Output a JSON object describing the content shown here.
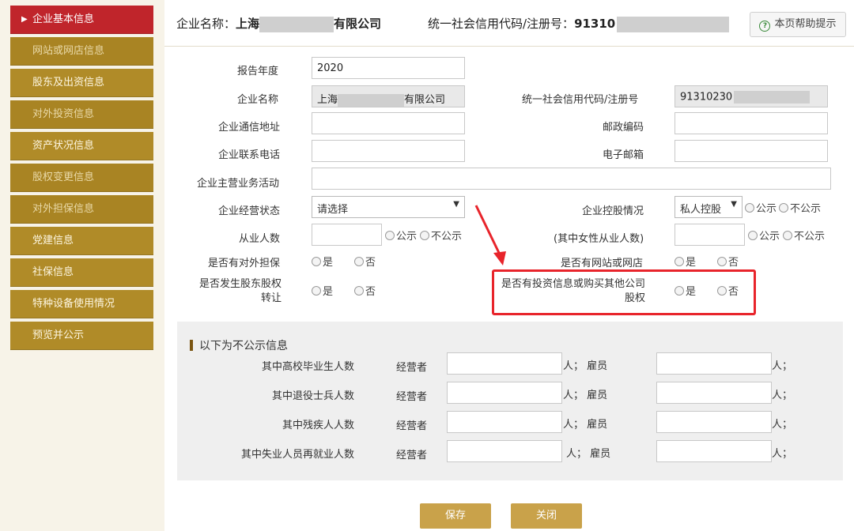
{
  "sidebar": {
    "items": [
      {
        "label": "企业基本信息"
      },
      {
        "label": "网站或网店信息"
      },
      {
        "label": "股东及出资信息"
      },
      {
        "label": "对外投资信息"
      },
      {
        "label": "资产状况信息"
      },
      {
        "label": "股权变更信息"
      },
      {
        "label": "对外担保信息"
      },
      {
        "label": "党建信息"
      },
      {
        "label": "社保信息"
      },
      {
        "label": "特种设备使用情况"
      },
      {
        "label": "预览并公示"
      }
    ],
    "active_arrow": "▶"
  },
  "header": {
    "company_label": "企业名称：",
    "company_prefix": "上海",
    "company_suffix": "有限公司",
    "code_label": "统一社会信用代码/注册号：",
    "code_prefix": "91310",
    "help_icon": "?",
    "help_label": "本页帮助提示"
  },
  "form": {
    "year_label": "报告年度",
    "year_value": "2020",
    "name_label": "企业名称",
    "name_prefix": "上海",
    "name_suffix": "有限公司",
    "code_label": "统一社会信用代码/注册号",
    "code_value": "91310230",
    "address_label": "企业通信地址",
    "postcode_label": "邮政编码",
    "phone_label": "企业联系电话",
    "email_label": "电子邮箱",
    "business_label": "企业主营业务活动",
    "status_label": "企业经营状态",
    "status_value": "请选择",
    "holding_label": "企业控股情况",
    "holding_value": "私人控股",
    "employees_label": "从业人数",
    "female_label": "(其中女性从业人数)",
    "guarantee_label": "是否有对外担保",
    "website_label": "是否有网站或网店",
    "transfer_label_1": "是否发生股东股权",
    "transfer_label_2": "转让",
    "invest_label_1": "是否有投资信息或购买其他公司",
    "invest_label_2": "股权",
    "public": "公示",
    "not_public": "不公示",
    "yes": "是",
    "no": "否",
    "caret": "▼"
  },
  "private": {
    "title": "以下为不公示信息",
    "rows": [
      {
        "label": "其中高校毕业生人数"
      },
      {
        "label": "其中退役士兵人数"
      },
      {
        "label": "其中残疾人人数"
      },
      {
        "label": "其中失业人员再就业人数"
      }
    ],
    "operator": "经营者",
    "unit_employee": "人；  雇员",
    "unit_end": "人；"
  },
  "buttons": {
    "save": "保存",
    "close": "关闭"
  },
  "colors": {
    "accent": "#c0252b",
    "nav": "#b08b28",
    "button": "#c9a24a",
    "highlight": "#e8242b"
  }
}
